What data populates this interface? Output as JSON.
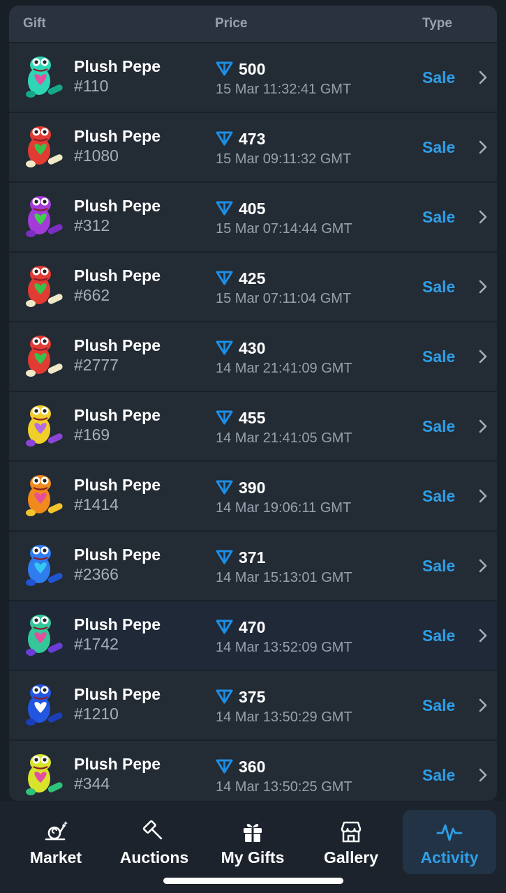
{
  "table": {
    "headers": {
      "gift": "Gift",
      "price": "Price",
      "type": "Type"
    },
    "rows": [
      {
        "name": "Plush Pepe",
        "number": "#110",
        "price": "500",
        "date": "15 Mar 11:32:41 GMT",
        "type": "Sale",
        "colors": [
          "#2fd6b6",
          "#e24f9e",
          "#16a78a"
        ]
      },
      {
        "name": "Plush Pepe",
        "number": "#1080",
        "price": "473",
        "date": "15 Mar 09:11:32 GMT",
        "type": "Sale",
        "colors": [
          "#e23b33",
          "#36c24a",
          "#f0e9c8"
        ]
      },
      {
        "name": "Plush Pepe",
        "number": "#312",
        "price": "405",
        "date": "15 Mar 07:14:44 GMT",
        "type": "Sale",
        "colors": [
          "#a23bd8",
          "#3fd04a",
          "#7b2ec2"
        ]
      },
      {
        "name": "Plush Pepe",
        "number": "#662",
        "price": "425",
        "date": "15 Mar 07:11:04 GMT",
        "type": "Sale",
        "colors": [
          "#e23b33",
          "#36c24a",
          "#f0e9c8"
        ]
      },
      {
        "name": "Plush Pepe",
        "number": "#2777",
        "price": "430",
        "date": "14 Mar 21:41:09 GMT",
        "type": "Sale",
        "colors": [
          "#e23b33",
          "#36c24a",
          "#f0e9c8"
        ]
      },
      {
        "name": "Plush Pepe",
        "number": "#169",
        "price": "455",
        "date": "14 Mar 21:41:05 GMT",
        "type": "Sale",
        "colors": [
          "#f1cf2a",
          "#b46de6",
          "#8a45d6"
        ]
      },
      {
        "name": "Plush Pepe",
        "number": "#1414",
        "price": "390",
        "date": "14 Mar 19:06:11 GMT",
        "type": "Sale",
        "colors": [
          "#f08a1c",
          "#e84e9a",
          "#f3c52d"
        ]
      },
      {
        "name": "Plush Pepe",
        "number": "#2366",
        "price": "371",
        "date": "14 Mar 15:13:01 GMT",
        "type": "Sale",
        "colors": [
          "#2f7cf0",
          "#34c7f0",
          "#1f55d0"
        ]
      },
      {
        "name": "Plush Pepe",
        "number": "#1742",
        "price": "470",
        "date": "14 Mar 13:52:09 GMT",
        "type": "Sale",
        "colors": [
          "#34c79a",
          "#e24f9e",
          "#6a3ed6"
        ]
      },
      {
        "name": "Plush Pepe",
        "number": "#1210",
        "price": "375",
        "date": "14 Mar 13:50:29 GMT",
        "type": "Sale",
        "colors": [
          "#2356e0",
          "#ffffff",
          "#1a3fb8"
        ]
      },
      {
        "name": "Plush Pepe",
        "number": "#344",
        "price": "360",
        "date": "14 Mar 13:50:25 GMT",
        "type": "Sale",
        "colors": [
          "#d8e32b",
          "#e24f9e",
          "#2fc27a"
        ]
      }
    ],
    "highlighted_row": 8
  },
  "nav": {
    "tabs": [
      {
        "label": "Market",
        "icon": "snail-market-icon",
        "active": false
      },
      {
        "label": "Auctions",
        "icon": "hammer-icon",
        "active": false
      },
      {
        "label": "My Gifts",
        "icon": "gift-icon",
        "active": false
      },
      {
        "label": "Gallery",
        "icon": "storefront-icon",
        "active": false
      },
      {
        "label": "Activity",
        "icon": "activity-icon",
        "active": true
      }
    ]
  },
  "colors": {
    "accent": "#2e9fe8",
    "ton": "#1e8fe6",
    "background": "#191f27",
    "card": "#232b35"
  }
}
